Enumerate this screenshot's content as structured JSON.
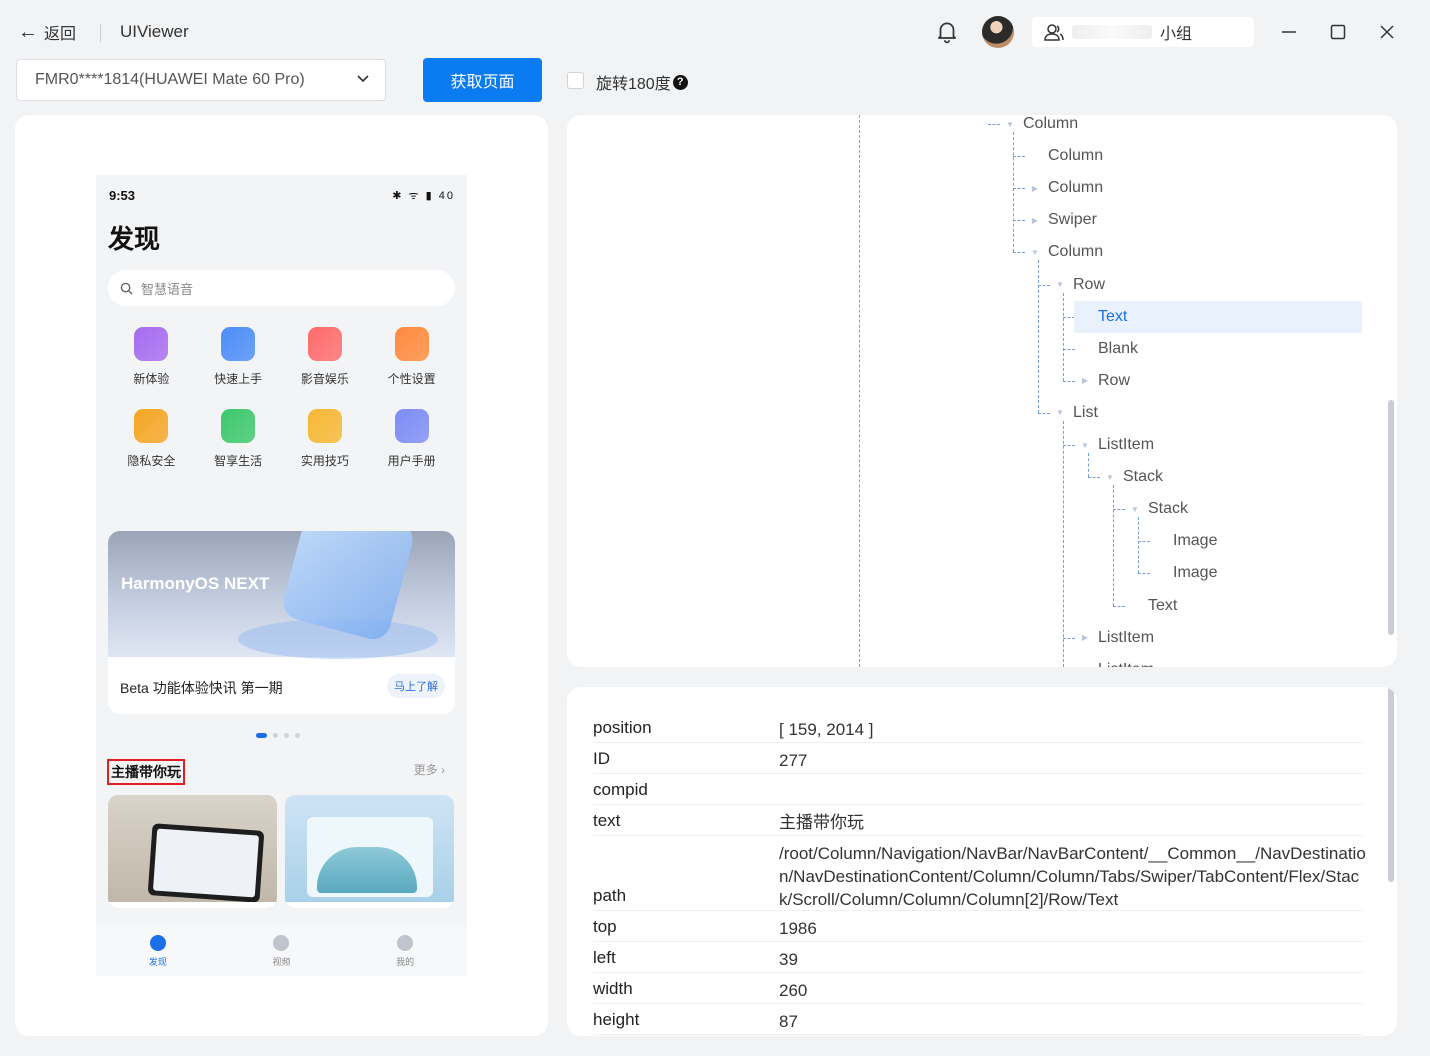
{
  "titlebar": {
    "back_label": "返回",
    "app_title": "UIViewer",
    "team_label": "小组"
  },
  "toolbar": {
    "device_value": "FMR0****1814(HUAWEI Mate 60 Pro)",
    "fetch_button": "获取页面",
    "rotate_label": "旋转180度",
    "rotate_checked": false
  },
  "phone": {
    "time": "9:53",
    "status_icons": "✱ ᯤ ▮ 40",
    "title": "发现",
    "search_placeholder": "智慧语音",
    "grid": [
      {
        "label": "新体验",
        "icon": "rocket-icon",
        "color": "#a66bf0"
      },
      {
        "label": "快速上手",
        "icon": "hand-icon",
        "color": "#4b8df8"
      },
      {
        "label": "影音娱乐",
        "icon": "camera-icon",
        "color": "#ff6b6b"
      },
      {
        "label": "个性设置",
        "icon": "palette-icon",
        "color": "#ff8a3d"
      },
      {
        "label": "隐私安全",
        "icon": "lock-icon",
        "color": "#f5a623"
      },
      {
        "label": "智享生活",
        "icon": "star-icon",
        "color": "#3cc86b"
      },
      {
        "label": "实用技巧",
        "icon": "grid-icon",
        "color": "#f7b733"
      },
      {
        "label": "用户手册",
        "icon": "book-icon",
        "color": "#7c8cf5"
      }
    ],
    "banner_title": "HarmonyOS NEXT",
    "banner_caption": "Beta 功能体验快讯 第一期",
    "banner_button": "马上了解",
    "section_title": "主播带你玩",
    "section_more": "更多 ›",
    "tabs": [
      {
        "label": "发现",
        "icon": "bulb-icon"
      },
      {
        "label": "视频",
        "icon": "video-icon"
      },
      {
        "label": "我的",
        "icon": "person-icon"
      }
    ]
  },
  "tree": {
    "nodes": [
      {
        "label": "Column",
        "toggle": "▼"
      },
      {
        "label": "Column",
        "toggle": ""
      },
      {
        "label": "Column",
        "toggle": "▶"
      },
      {
        "label": "Swiper",
        "toggle": "▶"
      },
      {
        "label": "Column",
        "toggle": "▼"
      },
      {
        "label": "Row",
        "toggle": "▼"
      },
      {
        "label": "Text",
        "toggle": "",
        "selected": true
      },
      {
        "label": "Blank",
        "toggle": ""
      },
      {
        "label": "Row",
        "toggle": "▶"
      },
      {
        "label": "List",
        "toggle": "▼"
      },
      {
        "label": "ListItem",
        "toggle": "▼"
      },
      {
        "label": "Stack",
        "toggle": "▼"
      },
      {
        "label": "Stack",
        "toggle": "▼"
      },
      {
        "label": "Image",
        "toggle": ""
      },
      {
        "label": "Image",
        "toggle": ""
      },
      {
        "label": "Text",
        "toggle": ""
      },
      {
        "label": "ListItem",
        "toggle": "▶"
      },
      {
        "label": "ListItem",
        "toggle": "▶"
      }
    ]
  },
  "properties": {
    "rows": [
      {
        "key": "position",
        "value": "[ 159, 2014 ]"
      },
      {
        "key": "ID",
        "value": "277"
      },
      {
        "key": "compid",
        "value": ""
      },
      {
        "key": "text",
        "value": "主播带你玩"
      },
      {
        "key": "path",
        "value": "/root/Column/Navigation/NavBar/NavBarContent/__Common__/NavDestination/NavDestinationContent/Column/Column/Tabs/Swiper/TabContent/Flex/Stack/Scroll/Column/Column/Column[2]/Row/Text"
      },
      {
        "key": "top",
        "value": "1986"
      },
      {
        "key": "left",
        "value": "39"
      },
      {
        "key": "width",
        "value": "260"
      },
      {
        "key": "height",
        "value": "87"
      }
    ]
  }
}
